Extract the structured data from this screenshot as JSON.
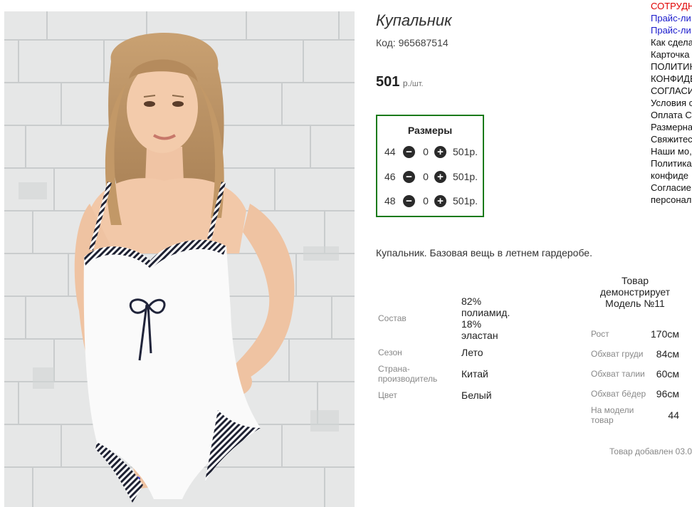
{
  "product": {
    "title": "Купальник",
    "code_label": "Код: 965687514",
    "price_value": "501",
    "price_unit": "р.",
    "price_per": "/шт.",
    "description": "Купальник. Базовая вещь в летнем гардеробе."
  },
  "sizes": {
    "title": "Размеры",
    "rows": [
      {
        "size": "44",
        "qty": "0",
        "price": "501р."
      },
      {
        "size": "46",
        "qty": "0",
        "price": "501р."
      },
      {
        "size": "48",
        "qty": "0",
        "price": "501р."
      }
    ]
  },
  "attributes": {
    "composition_label": "Состав",
    "composition_value_1": "82%",
    "composition_value_2": "полиамид.",
    "composition_value_3": "18%",
    "composition_value_4": "эластан",
    "season_label": "Сезон",
    "season_value": "Лето",
    "country_label_1": "Страна-",
    "country_label_2": "производитель",
    "country_value": "Китай",
    "color_label": "Цвет",
    "color_value": "Белый"
  },
  "model": {
    "head_1": "Товар",
    "head_2": "демонстрирует",
    "head_3": "Модель №11",
    "rows": [
      {
        "label": "Рост",
        "value": "170см"
      },
      {
        "label": "Обхват груди",
        "value": "84см"
      },
      {
        "label": "Обхват талии",
        "value": "60см"
      },
      {
        "label": "Обхват бёдер",
        "value": "96см"
      }
    ],
    "on_model_label_1": "На модели",
    "on_model_label_2": "товар",
    "on_model_value": "44"
  },
  "added_text": "Товар добавлен 03.0",
  "side_menu": [
    {
      "text": "СОТРУДН",
      "color": "#e00000"
    },
    {
      "text": "Прайс-ли",
      "color": "#1a1acc"
    },
    {
      "text": "Прайс-ли",
      "color": "#1a1acc"
    },
    {
      "text": "Как сдела",
      "color": "#111111"
    },
    {
      "text": "Карточка",
      "color": "#111111"
    },
    {
      "text": "ПОЛИТИК",
      "color": "#111111"
    },
    {
      "text": "КОНФИДЕ",
      "color": "#111111"
    },
    {
      "text": "СОГЛАСИ",
      "color": "#111111"
    },
    {
      "text": "Условия с",
      "color": "#111111"
    },
    {
      "text": "Оплата С",
      "color": "#111111"
    },
    {
      "text": "Размерна",
      "color": "#111111"
    },
    {
      "text": "Свяжитес",
      "color": "#111111"
    },
    {
      "text": "Наши мо,",
      "color": "#111111"
    },
    {
      "text": "Политика",
      "color": "#111111"
    },
    {
      "text": "конфиде",
      "color": "#111111"
    },
    {
      "text": "Согласие",
      "color": "#111111"
    },
    {
      "text": "персонал",
      "color": "#111111"
    }
  ],
  "icons": {
    "minus": "minus-circle-icon",
    "plus": "plus-circle-icon"
  },
  "colors": {
    "sizes_border": "#1a7a1a",
    "menu_red": "#e00000",
    "menu_blue": "#1a1acc"
  }
}
